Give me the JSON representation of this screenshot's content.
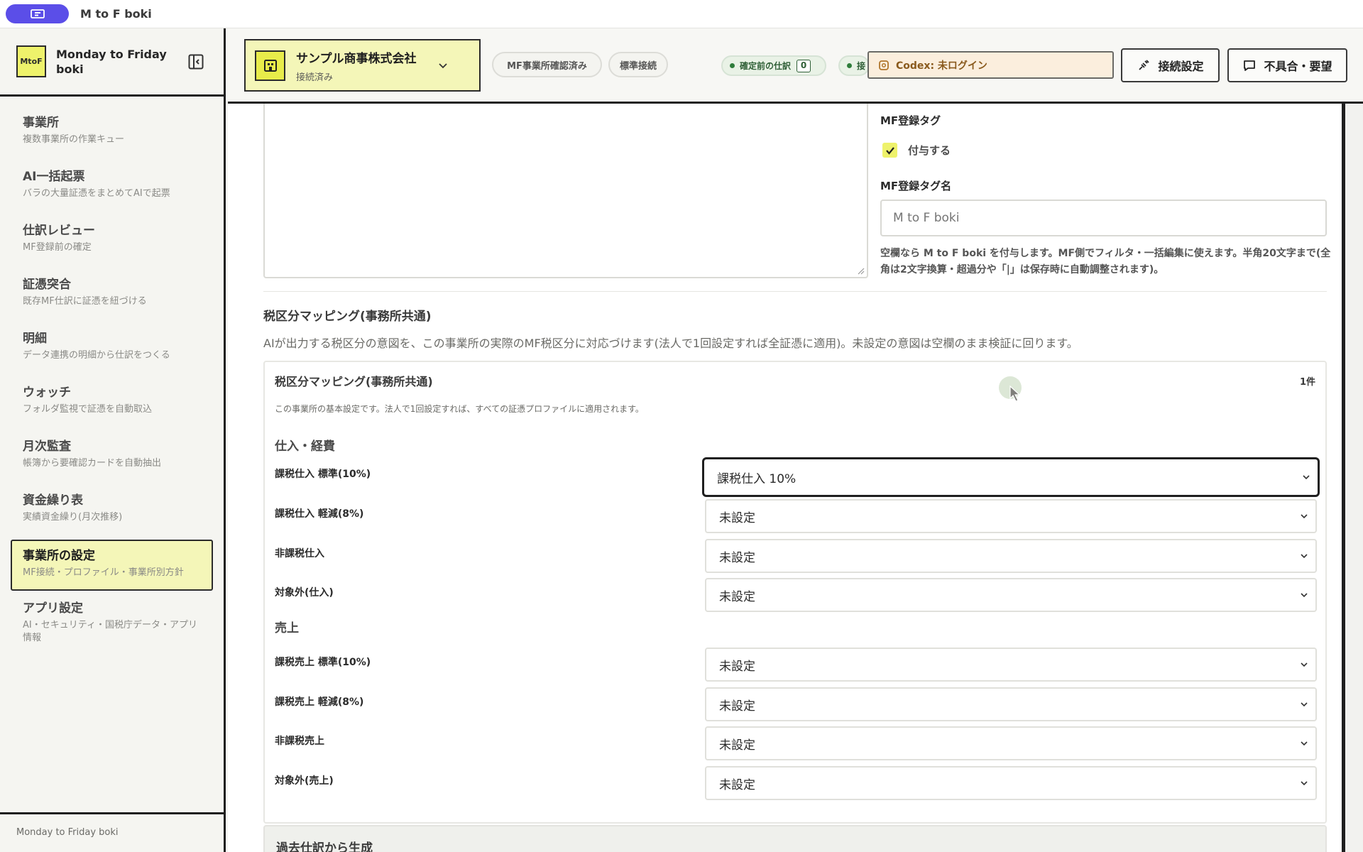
{
  "window": {
    "title": "M to F boki"
  },
  "sidebar": {
    "brand_logo": "MtoF",
    "brand_name": "Monday to Friday boki",
    "items": [
      {
        "label": "事業所",
        "sub": "複数事業所の作業キュー"
      },
      {
        "label": "AI一括起票",
        "sub": "バラの大量証憑をまとめてAIで起票"
      },
      {
        "label": "仕訳レビュー",
        "sub": "MF登録前の確定"
      },
      {
        "label": "証憑突合",
        "sub": "既存MF仕訳に証憑を紐づける"
      },
      {
        "label": "明細",
        "sub": "データ連携の明細から仕訳をつくる"
      },
      {
        "label": "ウォッチ",
        "sub": "フォルダ監視で証憑を自動取込"
      },
      {
        "label": "月次監査",
        "sub": "帳簿から要確認カードを自動抽出"
      },
      {
        "label": "資金繰り表",
        "sub": "実績資金繰り(月次推移)"
      },
      {
        "label": "事業所の設定",
        "sub": "MF接続・プロファイル・事業所別方針"
      },
      {
        "label": "アプリ設定",
        "sub": "AI・セキュリティ・国税庁データ・アプリ情報"
      }
    ],
    "footer": "Monday to Friday boki"
  },
  "header": {
    "company_name": "サンプル商事株式会社",
    "company_status": "接続済み",
    "pill_confirmed": "MF事業所確認済み",
    "pill_standard": "標準接続",
    "status_pending_label": "確定前の仕訳",
    "status_pending_count": "0",
    "status_cut": "接",
    "codex": "Codex: 未ログイン",
    "connect_btn": "接続設定",
    "feedback_btn": "不具合・要望"
  },
  "main": {
    "tag_label": "MF登録タグ",
    "tag_check_label": "付与する",
    "tag_name_label": "MF登録タグ名",
    "tag_name_placeholder": "M to F boki",
    "tag_help": "空欄なら M to F boki を付与します。MF側でフィルタ・一括編集に使えます。半角20文字まで(全角は2文字換算・超過分や「|」は保存時に自動調整されます)。",
    "section_title": "税区分マッピング(事務所共通)",
    "section_desc": "AIが出力する税区分の意図を、この事業所の実際のMF税区分に対応づけます(法人で1回設定すれば全証憑に適用)。未設定の意図は空欄のまま検証に回ります。",
    "card_title": "税区分マッピング(事務所共通)",
    "card_count": "1件",
    "card_note": "この事業所の基本設定です。法人で1回設定すれば、すべての証憑プロファイルに適用されます。",
    "group_purchase": "仕入・経費",
    "group_sales": "売上",
    "purchase_rows": [
      {
        "label": "課税仕入 標準(10%)",
        "value": "課税仕入 10%"
      },
      {
        "label": "課税仕入 軽減(8%)",
        "value": "未設定"
      },
      {
        "label": "非課税仕入",
        "value": "未設定"
      },
      {
        "label": "対象外(仕入)",
        "value": "未設定"
      }
    ],
    "sales_rows": [
      {
        "label": "課税売上 標準(10%)",
        "value": "未設定"
      },
      {
        "label": "課税売上 軽減(8%)",
        "value": "未設定"
      },
      {
        "label": "非課税売上",
        "value": "未設定"
      },
      {
        "label": "対象外(売上)",
        "value": "未設定"
      }
    ],
    "gen_title": "過去仕訳から生成"
  },
  "colors": {
    "accent_yellow": "#f4f6b8",
    "brand_purple": "#5b4ee8",
    "status_green": "#2f7d3b",
    "codex_bg": "#fbeedd"
  }
}
